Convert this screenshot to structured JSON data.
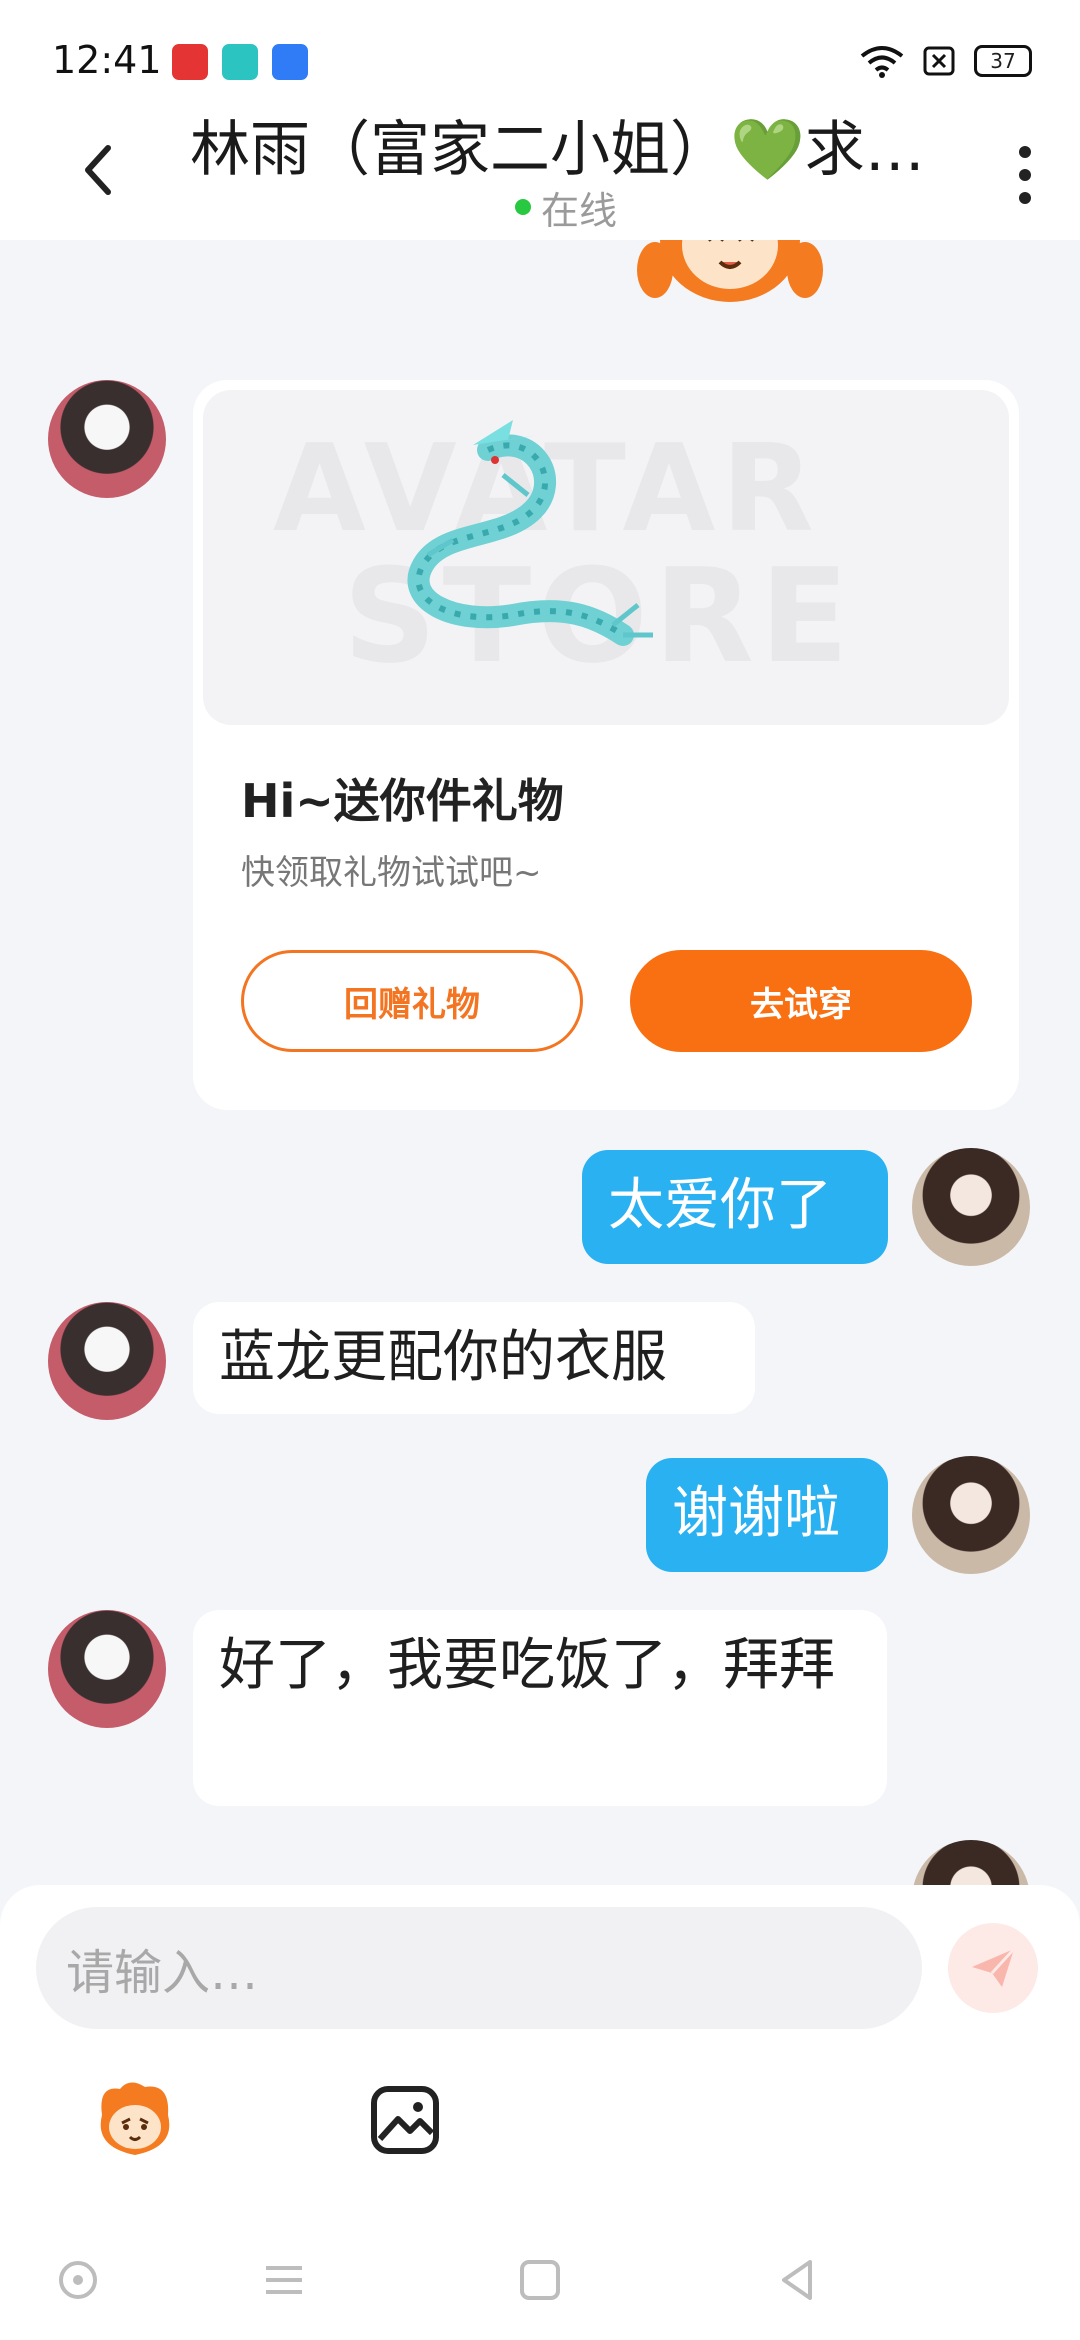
{
  "status_bar": {
    "time": "12:41",
    "battery": "37",
    "app_icons": [
      "red-app-icon",
      "teal-app-icon",
      "blue-app-icon"
    ],
    "right_icons": [
      "wifi-icon",
      "sim-off-icon",
      "battery-icon"
    ]
  },
  "header": {
    "title": "林雨（富家二小姐）💚求…",
    "status": "在线",
    "status_color": "#28c840"
  },
  "messages": [
    {
      "type": "gift_card",
      "from": "other",
      "image_watermark_1": "AVATAR",
      "image_watermark_2": "STORE",
      "title": "Hi~送你件礼物",
      "subtitle": "快领取礼物试试吧~",
      "button_secondary": "回赠礼物",
      "button_primary": "去试穿"
    },
    {
      "type": "text",
      "from": "me",
      "text": "太爱你了"
    },
    {
      "type": "text",
      "from": "other",
      "text": "蓝龙更配你的衣服"
    },
    {
      "type": "text",
      "from": "me",
      "text": "谢谢啦"
    },
    {
      "type": "text",
      "from": "other",
      "text": "好了，我要吃饭了，拜拜"
    }
  ],
  "composer": {
    "placeholder": "请输入…",
    "send_icon": "paper-plane-icon",
    "tools": [
      "mascot-sticker-icon",
      "image-icon"
    ]
  },
  "colors": {
    "accent_orange": "#f87012",
    "outgoing_bubble": "#2ab1f2",
    "background": "#f3f5f9"
  },
  "nav_bar": [
    "circle-nav-icon",
    "menu-nav-icon",
    "home-square-icon",
    "back-triangle-icon"
  ]
}
